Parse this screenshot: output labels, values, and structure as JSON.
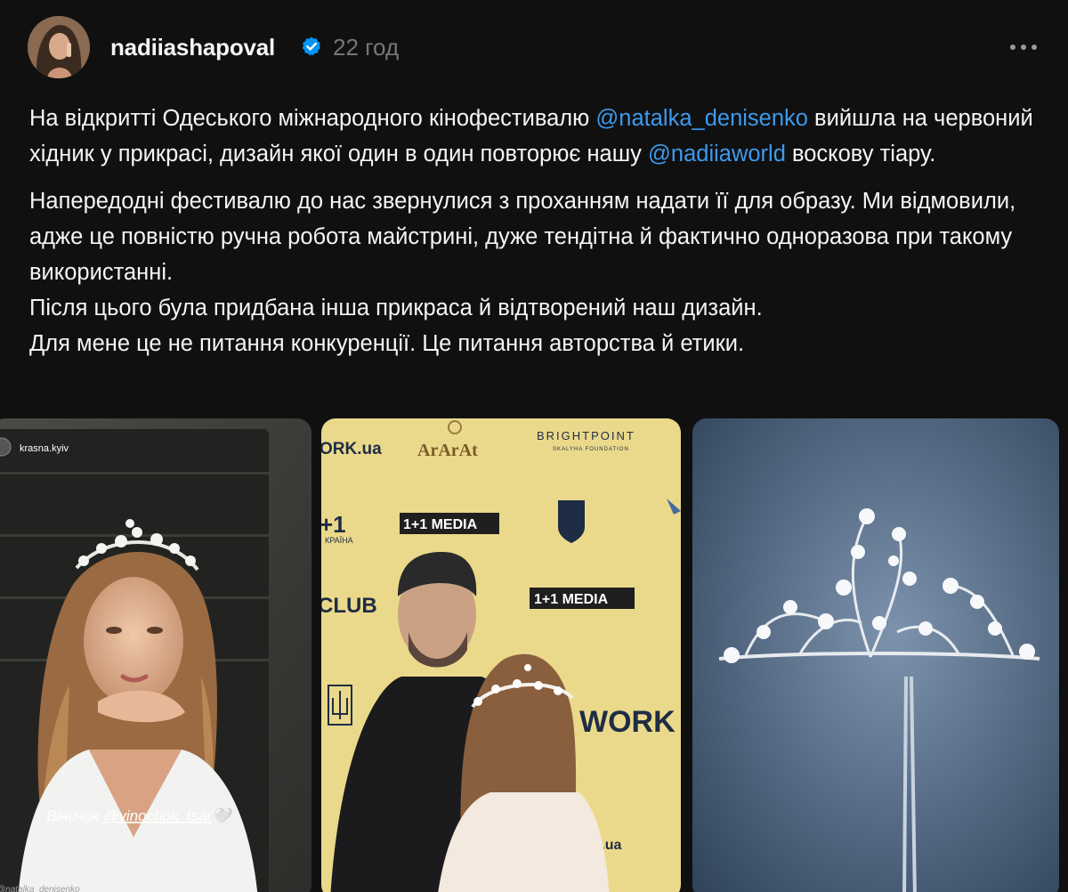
{
  "post": {
    "username": "nadiiashapoval",
    "time": "22 год",
    "paragraph1": {
      "part1": "На відкритті Одеського міжнародного кінофестивалю ",
      "mention1": "@natalka_denisenko",
      "part2": " вийшла на червоний хідник у прикрасі, дизайн якої один в один повторює нашу ",
      "mention2": "@nadiiaworld",
      "part3": " воскову тіару."
    },
    "paragraph2": {
      "line1": "Напередодні фестивалю до нас звернулися з проханням надати її для образу. Ми відмовили, адже це повністю ручна робота майстрині, дуже тендітна й фактично одноразова при такому використанні.",
      "line2": "Після цього була придбана інша прикраса й відтворений наш дизайн.",
      "line3": "Для мене це не питання конкуренції. Це питання авторства й етики."
    }
  },
  "gallery": {
    "image1": {
      "story_account": "krasna.kyiv",
      "caption_prefix": "Віночок ",
      "caption_mention": "@vinochok_tsar",
      "caption_heart": "🤍",
      "watermark": "@natalka_denisenko"
    },
    "image2": {
      "logo_work": "ORK.ua",
      "logo_ararat": "ArArAt",
      "logo_brightpoint": "BRIGHTPOINT",
      "logo_brightpoint_sub": "SKALYHA FOUNDATION",
      "logo_1plus1": "+1",
      "logo_1plus1_sub": "КРАЇНА",
      "logo_media1": "1+1 MEDIA",
      "logo_club": "CLUB",
      "logo_media2": "1+1 MEDIA",
      "logo_work2": "WORK",
      "logo_er": "er.ua"
    }
  },
  "colors": {
    "background": "#101010",
    "text": "#f3f5f7",
    "secondary": "#777777",
    "mention": "#3d9aed",
    "verified": "#0095f6"
  }
}
